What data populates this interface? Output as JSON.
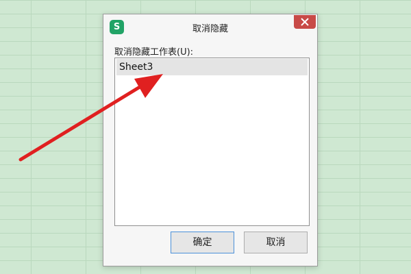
{
  "dialog": {
    "title": "取消隐藏",
    "app_icon_letter": "S",
    "list_label": "取消隐藏工作表(U):",
    "sheets": [
      "Sheet3"
    ],
    "ok_label": "确定",
    "cancel_label": "取消"
  },
  "colors": {
    "background": "#cfe8d2",
    "app_icon": "#21a366",
    "close_button": "#c84a47",
    "arrow": "#e02020"
  },
  "icons": {
    "app": "wps-spreadsheet-icon",
    "close": "close-icon",
    "pointer": "red-arrow-annotation"
  }
}
